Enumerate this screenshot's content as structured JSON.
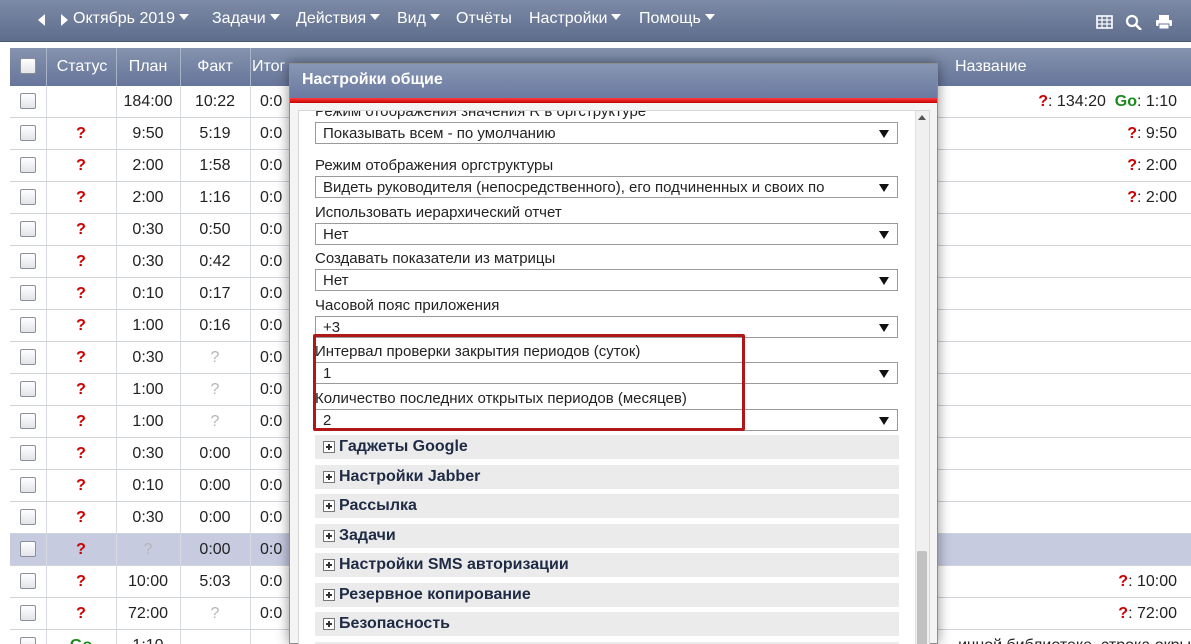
{
  "toolbar": {
    "period": "Октябрь 2019",
    "menu": [
      "Задачи",
      "Действия",
      "Вид",
      "Отчёты",
      "Настройки",
      "Помощь"
    ],
    "icons": [
      "table-icon",
      "search-icon",
      "print-icon"
    ]
  },
  "grid": {
    "columns": {
      "status": "Статус",
      "plan": "План",
      "fact": "Факт",
      "total": "Итог",
      "name": "Название"
    },
    "rows": [
      {
        "status": "",
        "plan": "184:00",
        "fact": "10:22",
        "total": "0:0",
        "right_q": "?",
        "right_v": ": 134:20",
        "right_go": "Go",
        "right_gv": ": 1:10"
      },
      {
        "status": "?",
        "plan": "9:50",
        "fact": "5:19",
        "total": "0:0",
        "right_q": "?",
        "right_v": ": 9:50"
      },
      {
        "status": "?",
        "plan": "2:00",
        "fact": "1:58",
        "total": "0:0",
        "right_q": "?",
        "right_v": ": 2:00"
      },
      {
        "status": "?",
        "plan": "2:00",
        "fact": "1:16",
        "total": "0:0",
        "right_q": "?",
        "right_v": ": 2:00"
      },
      {
        "status": "?",
        "plan": "0:30",
        "fact": "0:50",
        "total": "0:0"
      },
      {
        "status": "?",
        "plan": "0:30",
        "fact": "0:42",
        "total": "0:0"
      },
      {
        "status": "?",
        "plan": "0:10",
        "fact": "0:17",
        "total": "0:0"
      },
      {
        "status": "?",
        "plan": "1:00",
        "fact": "0:16",
        "total": "0:0"
      },
      {
        "status": "?",
        "plan": "0:30",
        "fact": "?",
        "total": "0:0"
      },
      {
        "status": "?",
        "plan": "1:00",
        "fact": "?",
        "total": "0:0"
      },
      {
        "status": "?",
        "plan": "1:00",
        "fact": "?",
        "total": "0:0"
      },
      {
        "status": "?",
        "plan": "0:30",
        "fact": "0:00",
        "total": "0:0"
      },
      {
        "status": "?",
        "plan": "0:10",
        "fact": "0:00",
        "total": "0:0"
      },
      {
        "status": "?",
        "plan": "0:30",
        "fact": "0:00",
        "total": "0:0"
      },
      {
        "status": "?",
        "plan": "?",
        "fact": "0:00",
        "total": "0:0",
        "selected": true
      },
      {
        "status": "?",
        "plan": "10:00",
        "fact": "5:03",
        "total": "0:0",
        "right_q": "?",
        "right_v": ": 10:00"
      },
      {
        "status": "?",
        "plan": "72:00",
        "fact": "?",
        "total": "0:0",
        "right_q": "?",
        "right_v": ": 72:00"
      },
      {
        "status": "Go",
        "plan": "1:10",
        "fact": "",
        "total": "",
        "right_text": "ичной библиотеке, строка окры"
      }
    ]
  },
  "dialog": {
    "title": "Настройки общие",
    "settings": [
      {
        "label": "Режим отображения значения R в оргструктуре",
        "value": "Показывать всем - по умолчанию"
      },
      {
        "label": "Режим отображения оргструктуры",
        "value": "Видеть руководителя (непосредственного), его подчиненных и своих по"
      },
      {
        "label": "Использовать иерархический отчет",
        "value": "Нет"
      },
      {
        "label": "Создавать показатели из матрицы",
        "value": "Нет"
      },
      {
        "label": "Часовой пояс приложения",
        "value": "+3"
      },
      {
        "label": "Интервал проверки закрытия периодов (суток)",
        "value": "1"
      },
      {
        "label": "Количество последних открытых периодов (месяцев)",
        "value": "2"
      }
    ],
    "sections": [
      "Гаджеты Google",
      "Настройки Jabber",
      "Рассылка",
      "Задачи",
      "Настройки SMS авторизации",
      "Резервное копирование",
      "Безопасность",
      ""
    ]
  }
}
